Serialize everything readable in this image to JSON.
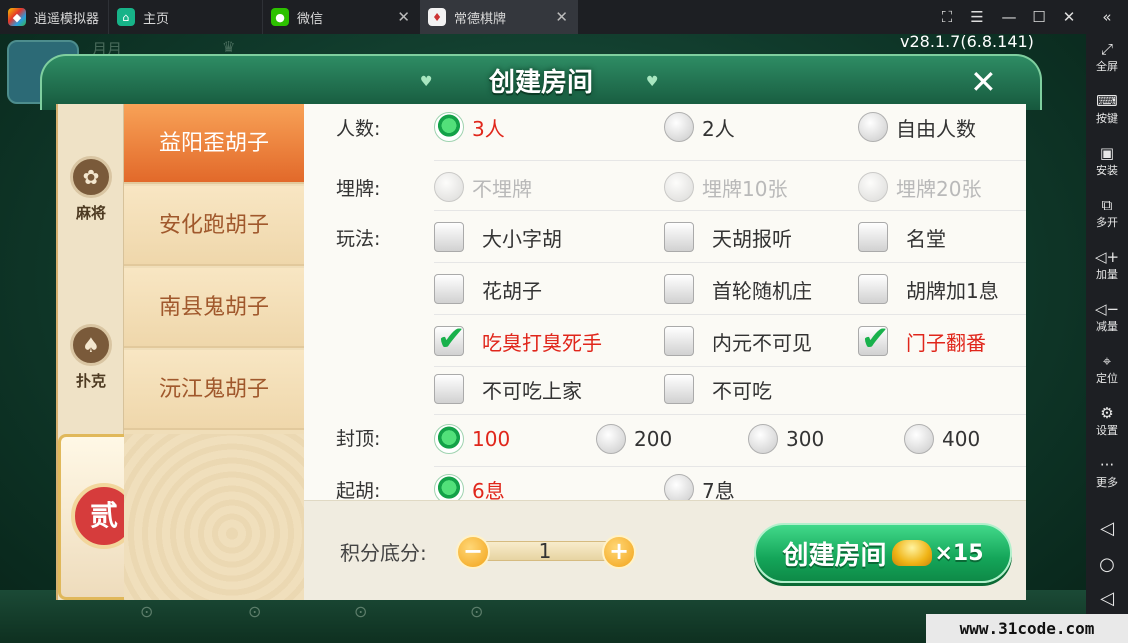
{
  "tabs": {
    "emulator": "逍遥模拟器",
    "home": "主页",
    "wechat": "微信",
    "game": "常德棋牌"
  },
  "sidebar": {
    "fullscreen": "全屏",
    "keys": "按键",
    "install": "安装",
    "multi": "多开",
    "vol_up": "加量",
    "vol_down": "减量",
    "location": "定位",
    "settings": "设置",
    "more": "更多"
  },
  "background": {
    "version": "v28.1.7(6.8.141)"
  },
  "dialog": {
    "title": "创建房间",
    "categories": [
      "麻将",
      "扑克"
    ],
    "seal_char": "贰",
    "game_types": [
      "益阳歪胡子",
      "安化跑胡子",
      "南县鬼胡子",
      "沅江鬼胡子"
    ],
    "rows": {
      "players": {
        "label": "人数:",
        "options": [
          "3人",
          "2人",
          "自由人数"
        ]
      },
      "bury": {
        "label": "埋牌:",
        "options": [
          "不埋牌",
          "埋牌10张",
          "埋牌20张"
        ]
      },
      "play": {
        "label": "玩法:",
        "options": [
          "大小字胡",
          "天胡报听",
          "名堂",
          "花胡子",
          "首轮随机庄",
          "胡牌加1息",
          "吃臭打臭死手",
          "内元不可见",
          "门子翻番",
          "不可吃上家",
          "不可吃"
        ]
      },
      "cap": {
        "label": "封顶:",
        "options": [
          "100",
          "200",
          "300",
          "400"
        ]
      },
      "start": {
        "label": "起胡:",
        "options": [
          "6息",
          "7息"
        ]
      }
    },
    "footer": {
      "score_label": "积分底分:",
      "score_value": "1",
      "create_label": "创建房间",
      "create_cost": "×15"
    }
  },
  "watermark": "www.31code.com",
  "colors": {
    "accent_green": "#14a559",
    "selected_red": "#e0261b",
    "active_tab_orange": "#e2692a"
  }
}
